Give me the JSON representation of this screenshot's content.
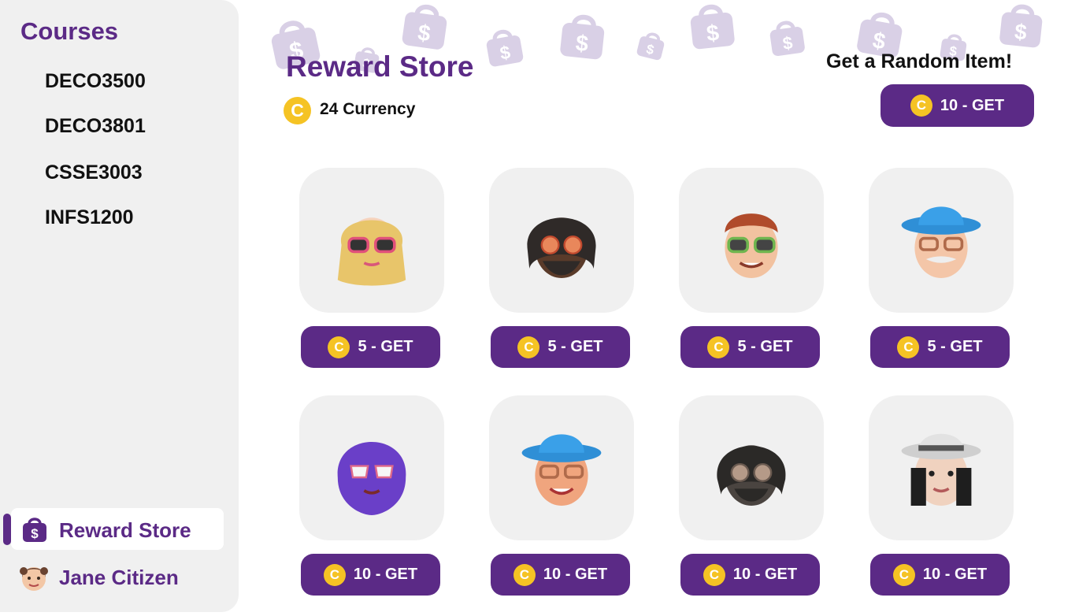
{
  "sidebar": {
    "courses_title": "Courses",
    "courses": [
      "DECO3500",
      "DECO3801",
      "CSSE3003",
      "INFS1200"
    ],
    "nav_reward_store": "Reward Store",
    "user_name": "Jane Citizen"
  },
  "header": {
    "title": "Reward Store",
    "currency_text": "24 Currency",
    "coin_symbol": "C",
    "random_title": "Get a Random Item!",
    "random_button": "10 - GET"
  },
  "store_items": [
    {
      "avatar": "blonde-woman-pink-sunglasses",
      "button": "5 - GET"
    },
    {
      "avatar": "man-dreadlocks-orange-glasses",
      "button": "5 - GET"
    },
    {
      "avatar": "redhead-man-green-sunglasses",
      "button": "5 - GET"
    },
    {
      "avatar": "old-man-blue-hat",
      "button": "5 - GET"
    },
    {
      "avatar": "woman-purple-hijab",
      "button": "10 - GET"
    },
    {
      "avatar": "man-blue-hat-glasses",
      "button": "10 - GET"
    },
    {
      "avatar": "man-dark-dreadlocks-glasses",
      "button": "10 - GET"
    },
    {
      "avatar": "woman-grey-hat",
      "button": "10 - GET"
    }
  ],
  "colors": {
    "brand": "#5b2a86",
    "coin": "#f5c324",
    "sidebar_bg": "#f0f0f0",
    "deco_bag": "#d9d0e6"
  },
  "icons": [
    "shopping-bag-dollar-icon",
    "coin-icon",
    "avatar-icon"
  ]
}
